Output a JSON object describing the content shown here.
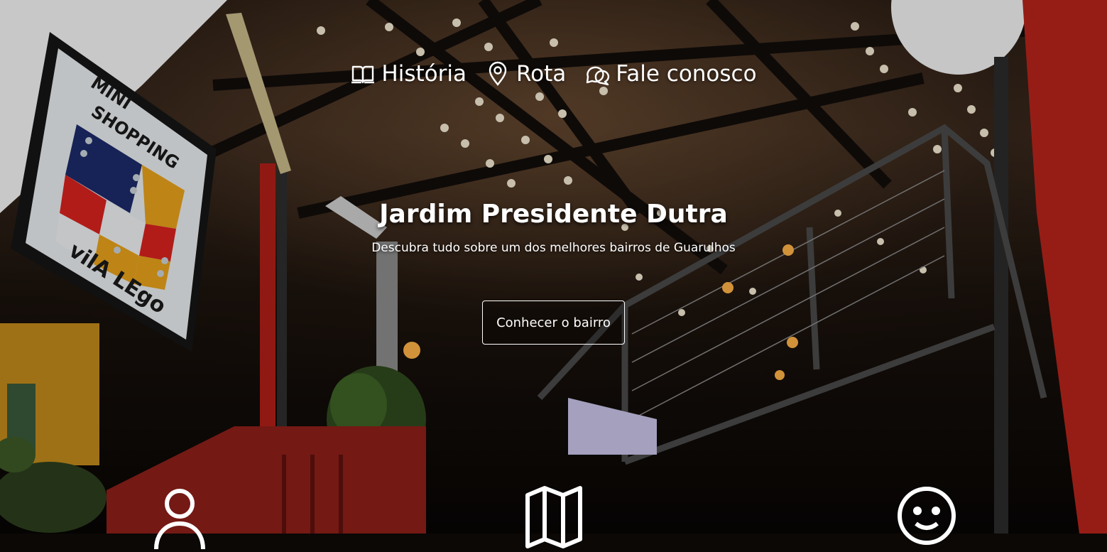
{
  "nav": {
    "items": [
      {
        "label": "História",
        "icon": "book-icon"
      },
      {
        "label": "Rota",
        "icon": "map-pin-icon"
      },
      {
        "label": "Fale conosco",
        "icon": "chat-bubbles-icon"
      }
    ]
  },
  "hero": {
    "title": "Jardim Presidente Dutra",
    "subtitle": "Descubra tudo sobre um dos melhores bairros de Guarulhos",
    "button_label": "Conhecer o bairro"
  },
  "features": {
    "icons": [
      "person-icon",
      "map-icon",
      "smile-face-icon"
    ]
  },
  "background": {
    "sign_text": [
      "MINI",
      "SHOPPING",
      "vilA LEgo"
    ],
    "colors": {
      "red_wall": "#b8241c",
      "sign_red": "#d8231e",
      "sign_yellow": "#e8a21a",
      "sign_navy": "#1d2a6a"
    }
  }
}
